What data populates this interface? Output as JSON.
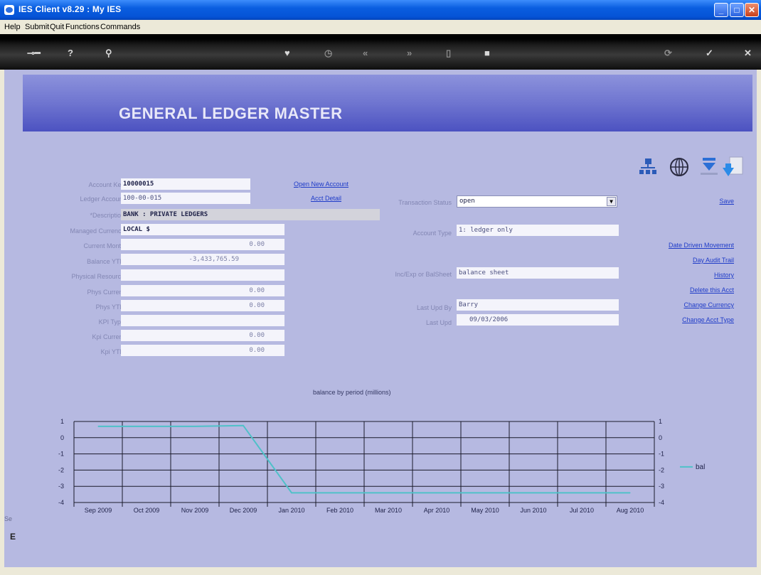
{
  "window": {
    "title": "IES Client v8.29 : My IES"
  },
  "menu": [
    "Help",
    "Submit",
    "Quit",
    "Functions",
    "Commands"
  ],
  "page_title": "GENERAL LEDGER MASTER",
  "form_left": {
    "account_key_label": "Account Key",
    "account_key": "10000015",
    "ledger_account_label": "Ledger Account",
    "ledger_account": "100-00-015",
    "description_label": "*Description",
    "description": "BANK : PRIVATE LEDGERS",
    "managed_currency_label": "Managed Currency",
    "managed_currency": "LOCAL $",
    "current_month_label": "Current Month",
    "current_month": "0.00",
    "balance_ytd_label": "Balance YTD",
    "balance_ytd": "-3,433,765.59",
    "physical_resource_label": "Physical Resource",
    "physical_resource": "",
    "phys_current_label": "Phys Current",
    "phys_current": "0.00",
    "phys_ytd_label": "Phys YTD",
    "phys_ytd": "0.00",
    "kpi_type_label": "KPI Type",
    "kpi_type": "",
    "kpi_current_label": "Kpi Current",
    "kpi_current": "0.00",
    "kpi_ytd_label": "Kpi YTD",
    "kpi_ytd": "0.00"
  },
  "form_right": {
    "transaction_status_label": "Transaction Status",
    "transaction_status": "open",
    "account_type_label": "Account Type",
    "account_type": "1: ledger only",
    "inc_exp_label": "Inc/Exp or BalSheet",
    "inc_exp": "balance sheet",
    "last_upd_by_label": "Last Upd By",
    "last_upd_by": "Barry",
    "last_upd_label": "Last Upd",
    "last_upd": "09/03/2006"
  },
  "links": {
    "open_new_account": "Open New Account",
    "acct_detail": "Acct Detail",
    "save": "Save",
    "date_driven_movement": "Date Driven Movement",
    "day_audit_trail": "Day Audit Trail",
    "history": "History",
    "delete_this_acct": "Delete this Acct",
    "change_currency": "Change Currency",
    "change_acct_type": "Change Acct Type"
  },
  "icons": [
    "hierarchy-icon",
    "globe-icon",
    "download-icon",
    "import-icon"
  ],
  "toolbar_icons": [
    "key-icon",
    "help-icon",
    "search-icon",
    "heart-icon",
    "clock-icon",
    "rewind-icon",
    "forward-icon",
    "page-icon",
    "stop-icon",
    "refresh-icon",
    "check-icon",
    "close-icon"
  ],
  "colors": {
    "accent": "#1f3cc8",
    "line": "#4fc1c8",
    "banner": "#6f75d0"
  },
  "chart_data": {
    "type": "line",
    "title": "balance by period (millions)",
    "categories": [
      "Sep 2009",
      "Oct 2009",
      "Nov 2009",
      "Dec 2009",
      "Jan 2010",
      "Feb 2010",
      "Mar 2010",
      "Apr 2010",
      "May 2010",
      "Jun 2010",
      "Jul 2010",
      "Aug 2010"
    ],
    "series": [
      {
        "name": "bal",
        "values": [
          0.7,
          0.7,
          0.7,
          0.75,
          -3.4,
          -3.4,
          -3.4,
          -3.4,
          -3.4,
          -3.4,
          -3.4,
          -3.4
        ]
      }
    ],
    "ylim": [
      -4,
      1
    ],
    "yticks": [
      "1",
      "0",
      "-1",
      "-2",
      "-3",
      "-4"
    ],
    "legend_position": "right",
    "grid": true
  },
  "status": {
    "left_text": "Se",
    "left_text2": "E"
  }
}
